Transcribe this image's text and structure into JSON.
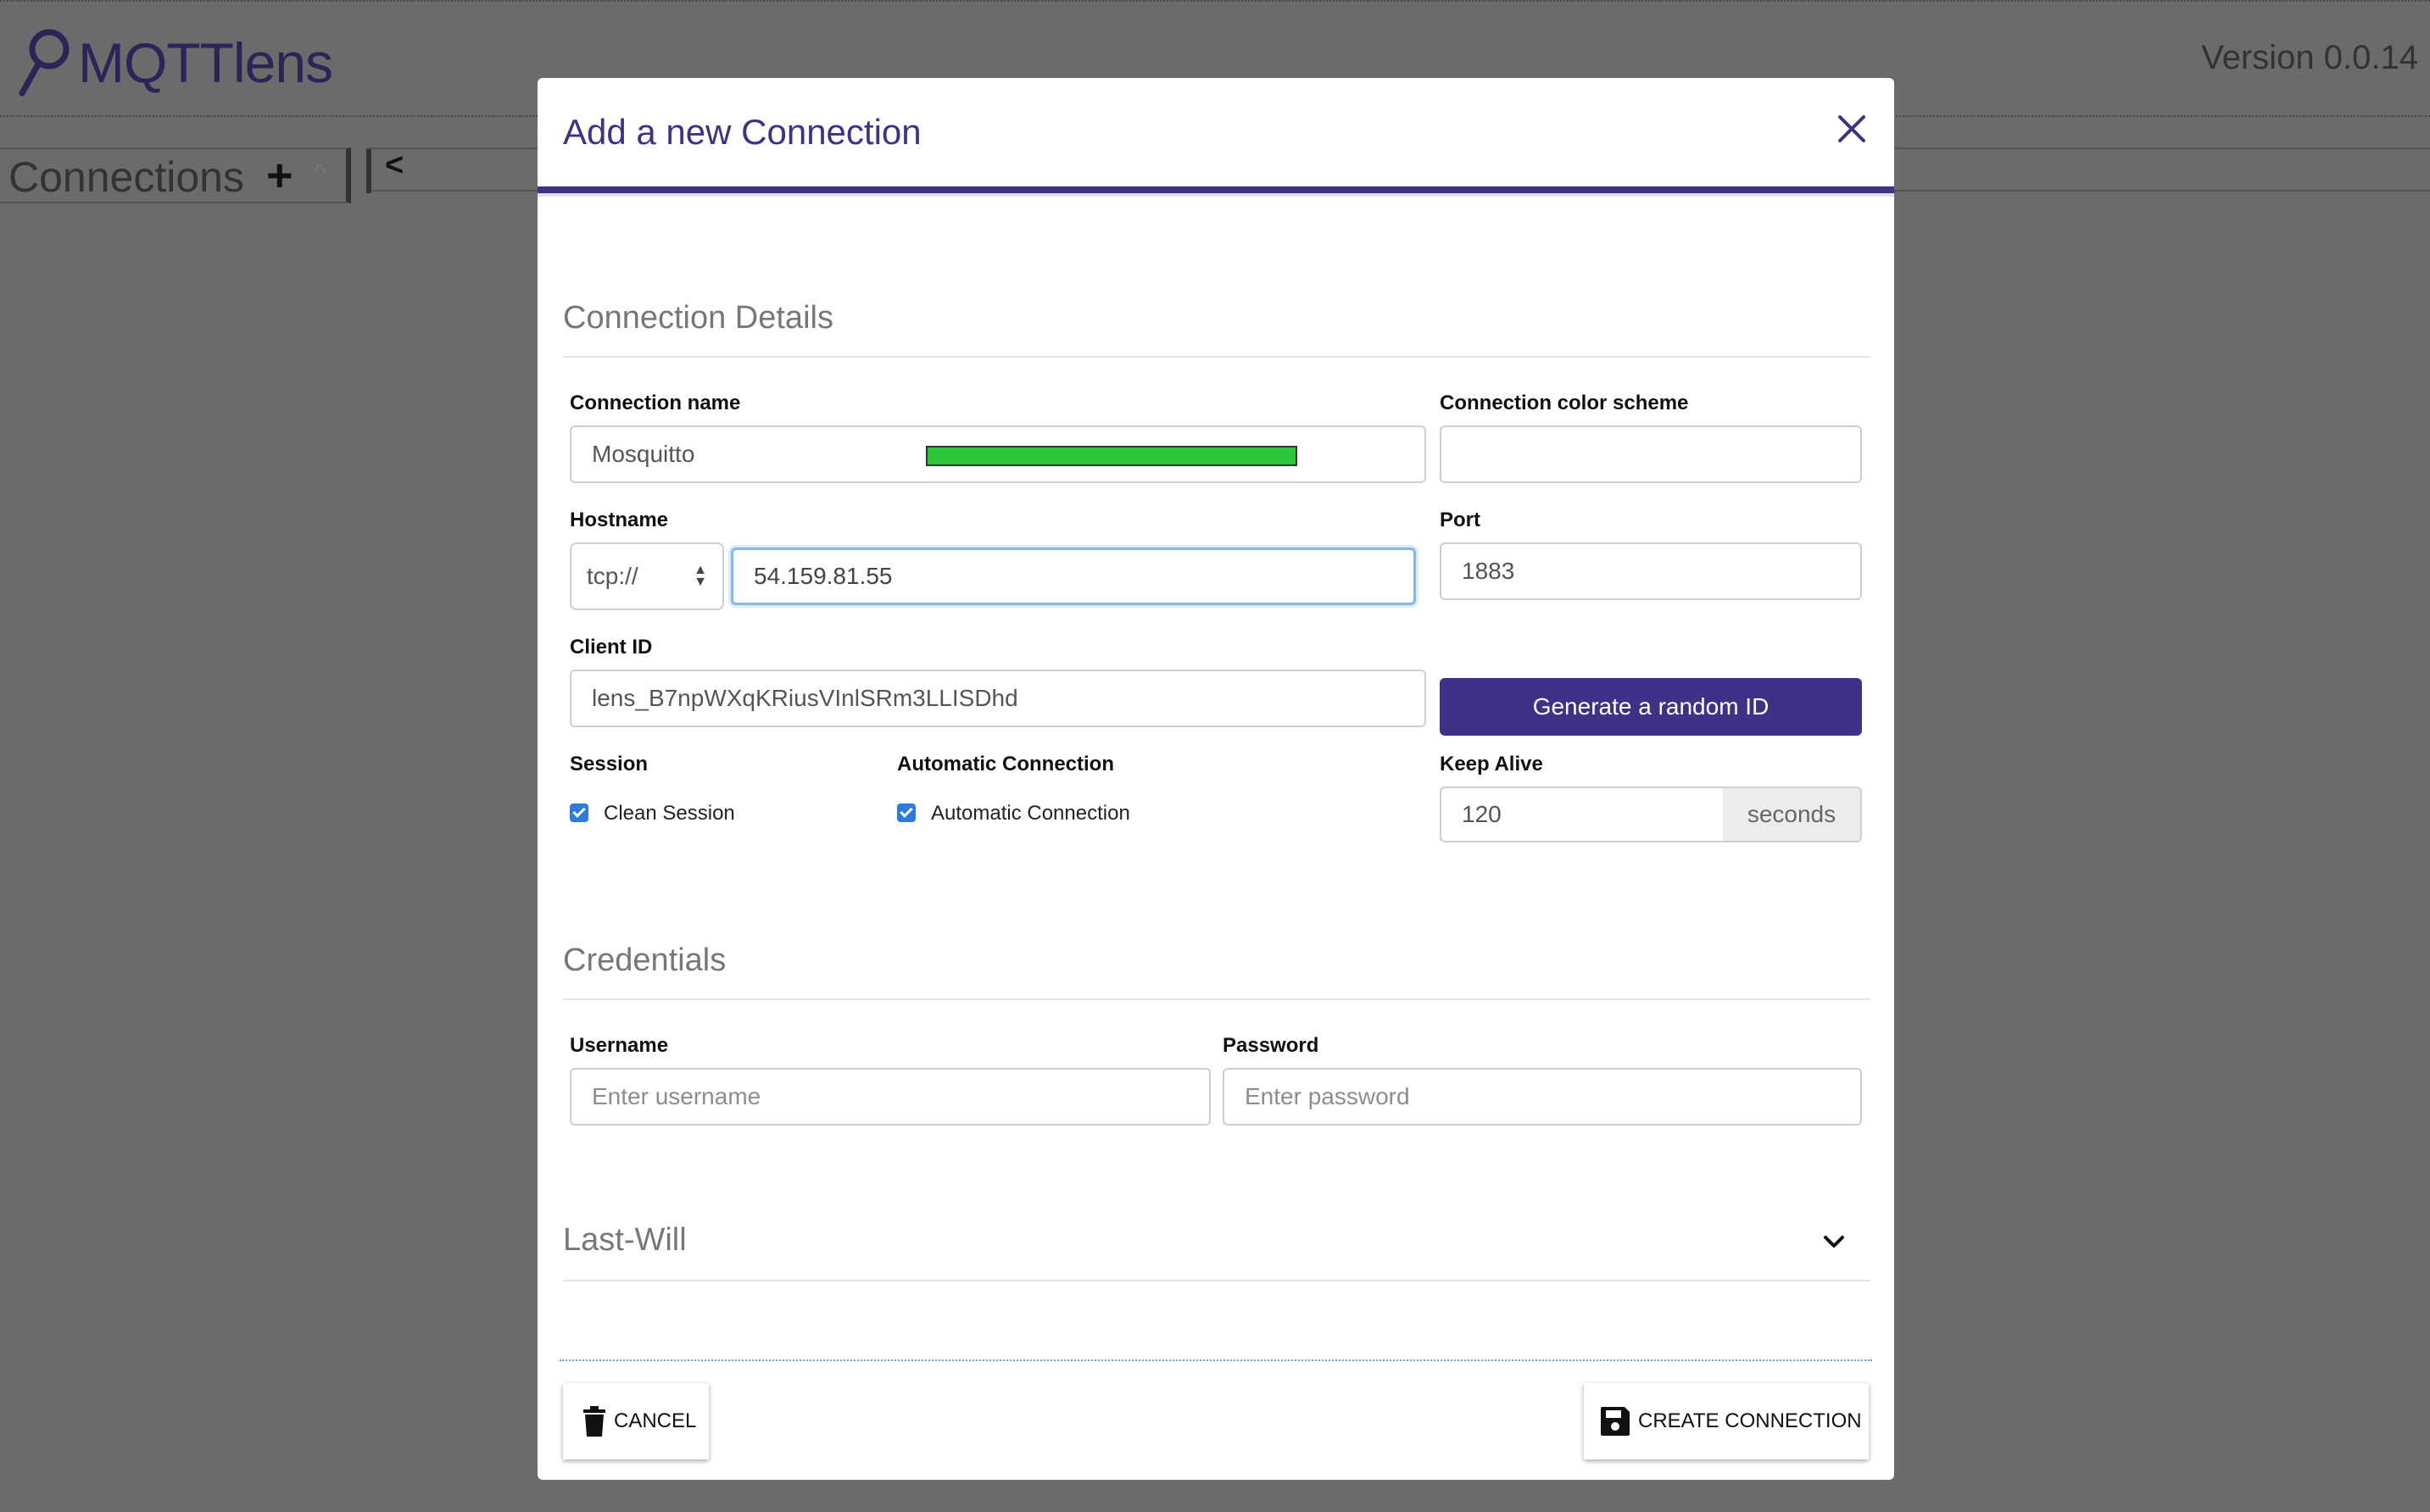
{
  "app": {
    "name": "MQTTlens",
    "version": "Version 0.0.14",
    "connections_title": "Connections",
    "add_symbol": "+",
    "collapse_symbol": "^",
    "sidebar_toggle": "<"
  },
  "modal": {
    "title": "Add a new Connection",
    "close_symbol": "×",
    "connection_details": {
      "section_title": "Connection Details",
      "name_label": "Connection name",
      "name_value": "Mosquitto",
      "color_label": "Connection color scheme",
      "color_value": "#2dc53a",
      "hostname_label": "Hostname",
      "protocol_value": "tcp://",
      "hostname_value": "54.159.81.55",
      "port_label": "Port",
      "port_value": "1883",
      "client_id_label": "Client ID",
      "client_id_value": "lens_B7npWXqKRiusVInlSRm3LLISDhd",
      "generate_button": "Generate a random ID",
      "session_label": "Session",
      "clean_session_label": "Clean Session",
      "clean_session_checked": true,
      "auto_conn_heading": "Automatic Connection",
      "auto_conn_label": "Automatic Connection",
      "auto_conn_checked": true,
      "keep_alive_label": "Keep Alive",
      "keep_alive_value": "120",
      "keep_alive_unit": "seconds"
    },
    "credentials": {
      "section_title": "Credentials",
      "username_label": "Username",
      "username_placeholder": "Enter username",
      "password_label": "Password",
      "password_placeholder": "Enter password"
    },
    "last_will": {
      "section_title": "Last-Will"
    },
    "footer": {
      "cancel_label": "CANCEL",
      "create_label": "CREATE CONNECTION"
    }
  },
  "colors": {
    "accent": "#3f3187",
    "overlay": "#6b6b6b",
    "checkbox": "#2e7be0"
  }
}
